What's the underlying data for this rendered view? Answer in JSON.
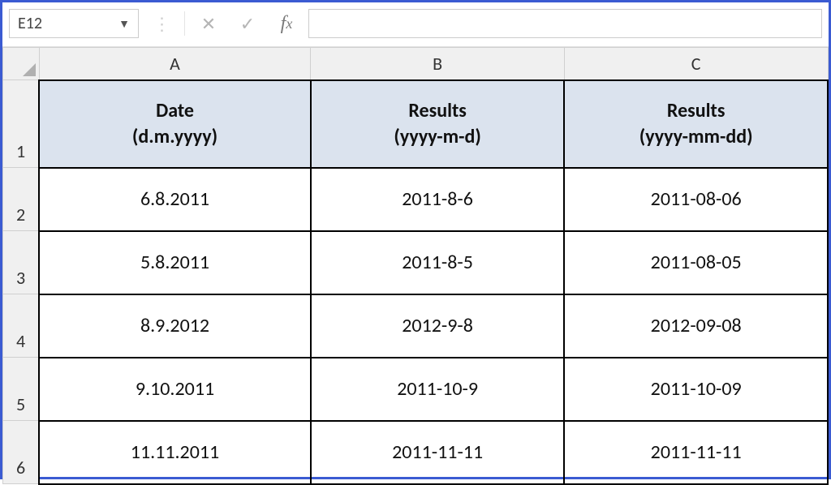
{
  "nameBox": {
    "value": "E12"
  },
  "formulaBar": {
    "value": ""
  },
  "columns": [
    "A",
    "B",
    "C"
  ],
  "headers": {
    "A": {
      "l1": "Date",
      "l2": "(d.m.yyyy)"
    },
    "B": {
      "l1": "Results",
      "l2": "(yyyy-m-d)"
    },
    "C": {
      "l1": "Results",
      "l2": "(yyyy-mm-dd)"
    }
  },
  "rows": [
    {
      "n": "2",
      "a": "6.8.2011",
      "b": "2011-8-6",
      "c": "2011-08-06"
    },
    {
      "n": "3",
      "a": "5.8.2011",
      "b": "2011-8-5",
      "c": "2011-08-05"
    },
    {
      "n": "4",
      "a": "8.9.2012",
      "b": "2012-9-8",
      "c": "2012-09-08"
    },
    {
      "n": "5",
      "a": "9.10.2011",
      "b": "2011-10-9",
      "c": "2011-10-09"
    },
    {
      "n": "6",
      "a": "11.11.2011",
      "b": "2011-11-11",
      "c": "2011-11-11"
    }
  ],
  "rowNums": {
    "headerRow": "1"
  }
}
